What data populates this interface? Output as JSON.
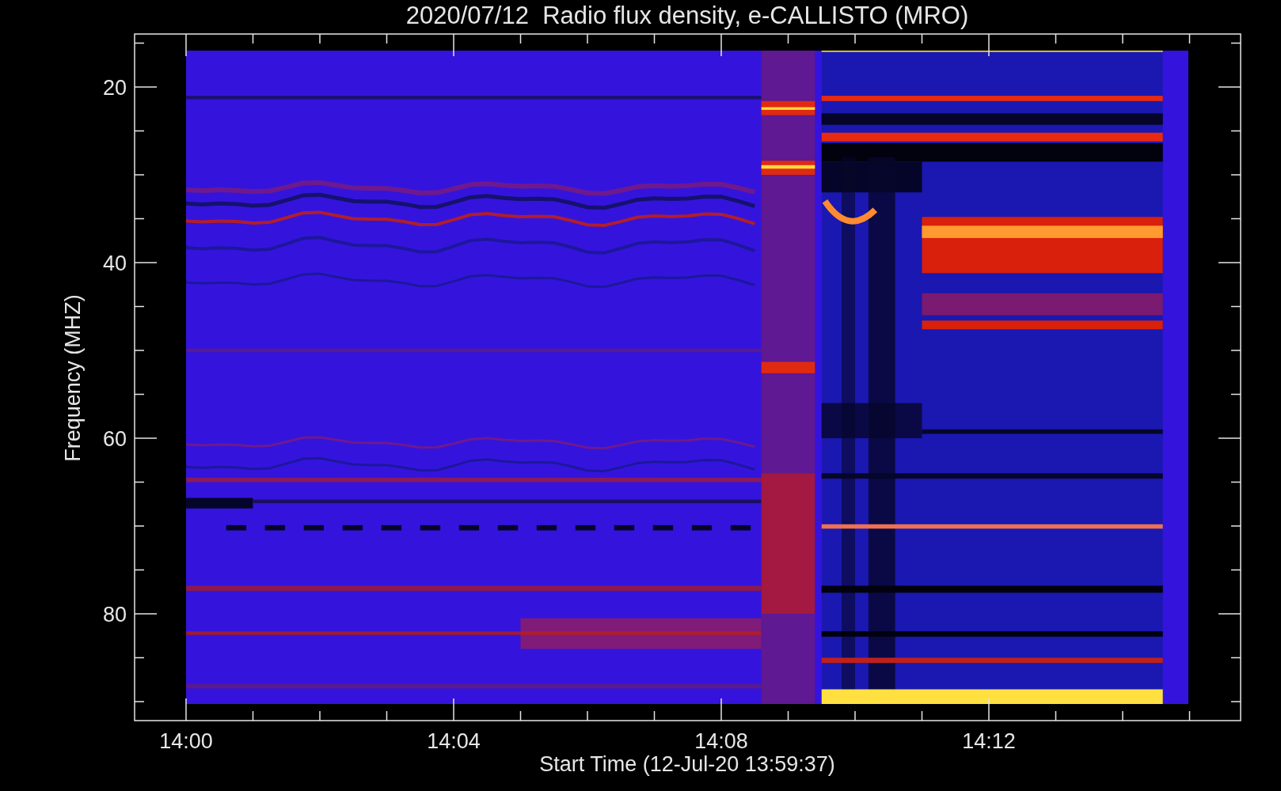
{
  "title": "2020/07/12  Radio flux density, e-CALLISTO (MRO)",
  "y_axis": {
    "label": "Frequency (MHZ)",
    "ticks": [
      "20",
      "40",
      "60",
      "80"
    ]
  },
  "x_axis": {
    "label": "Start Time (12-Jul-20 13:59:37)",
    "ticks": [
      "14:00",
      "14:04",
      "14:08",
      "14:12"
    ]
  }
}
